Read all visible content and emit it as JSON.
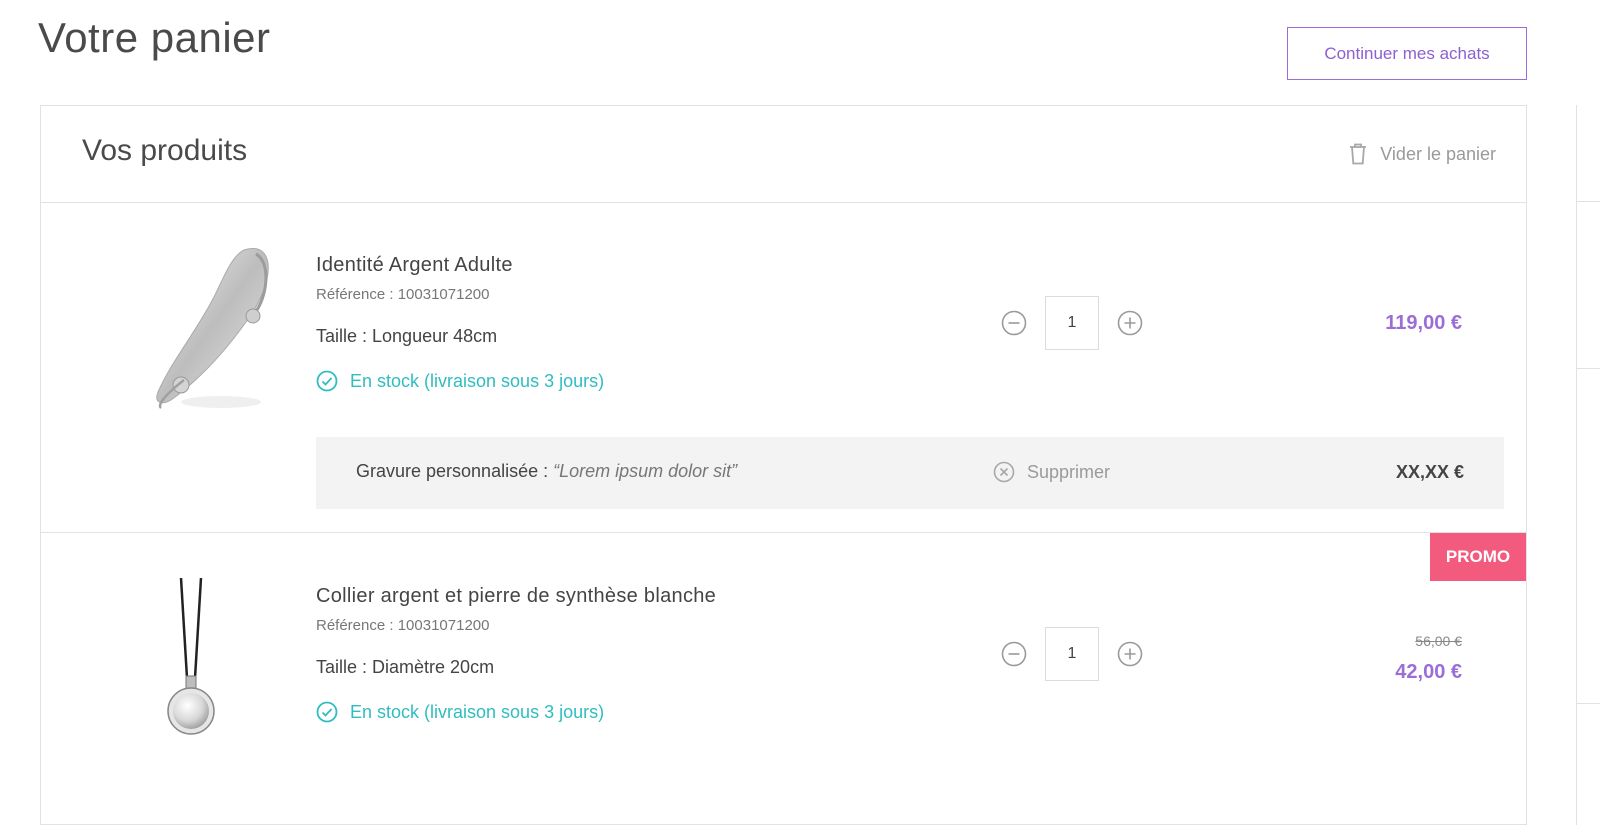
{
  "header": {
    "title": "Votre panier",
    "continue_label": "Continuer mes achats"
  },
  "cart": {
    "section_title": "Vos produits",
    "empty_label": "Vider le panier",
    "items": [
      {
        "name": "Identité Argent Adulte",
        "reference": "Référence : 10031071200",
        "size": "Taille : Longueur 48cm",
        "stock": "En stock (livraison sous 3 jours)",
        "quantity": "1",
        "price": "119,00 €",
        "engraving": {
          "label": "Gravure personnalisée : ",
          "value": "“Lorem ipsum dolor sit”",
          "remove_label": "Supprimer",
          "price": "XX,XX €"
        }
      },
      {
        "name": "Collier argent et pierre de synthèse blanche",
        "reference": "Référence : 10031071200",
        "size": "Taille : Diamètre 20cm",
        "stock": "En stock (livraison sous 3 jours)",
        "quantity": "1",
        "old_price": "56,00 €",
        "price": "42,00 €",
        "badge": "PROMO"
      }
    ]
  },
  "icons": {
    "trash": "trash-icon",
    "stock": "check-circle-icon",
    "minus": "minus-circle-icon",
    "plus": "plus-circle-icon",
    "remove": "close-circle-icon"
  },
  "colors": {
    "accent": "#9b6dd6",
    "stock": "#2fbdc1",
    "promo": "#f25a7e"
  }
}
